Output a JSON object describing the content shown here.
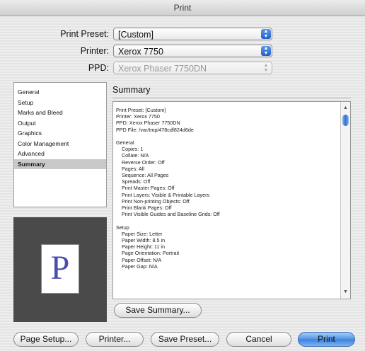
{
  "window": {
    "title": "Print"
  },
  "settings": {
    "print_preset": {
      "label": "Print Preset:",
      "value": "[Custom]"
    },
    "printer": {
      "label": "Printer:",
      "value": "Xerox 7750"
    },
    "ppd": {
      "label": "PPD:",
      "value": "Xerox Phaser 7750DN"
    }
  },
  "sidebar": {
    "items": [
      {
        "label": "General"
      },
      {
        "label": "Setup"
      },
      {
        "label": "Marks and Bleed"
      },
      {
        "label": "Output"
      },
      {
        "label": "Graphics"
      },
      {
        "label": "Color Management"
      },
      {
        "label": "Advanced"
      },
      {
        "label": "Summary",
        "selected": true
      }
    ]
  },
  "preview": {
    "letter": "P"
  },
  "summary": {
    "heading": "Summary",
    "text": "Print Preset: [Custom]\nPrinter: Xerox 7750\nPPD: Xerox Phaser 7750DN\nPPD File: /var/tmp/478cdf824d6de\n\nGeneral\n    Copies: 1\n    Collate: N/A\n    Reverse Order: Off\n    Pages: All\n    Sequence: All Pages\n    Spreads: Off\n    Print Master Pages: Off\n    Print Layers: Visible & Printable Layers\n    Print Non-printing Objects: Off\n    Print Blank Pages: Off\n    Print Visible Guides and Baseline Grids: Off\n\nSetup\n    Paper Size: Letter\n    Paper Width: 8.5 in\n    Paper Height: 11 in\n    Page Orientation: Portrait\n    Paper Offset: N/A\n    Paper Gap: N/A"
  },
  "buttons": {
    "save_summary": "Save Summary...",
    "page_setup": "Page Setup...",
    "printer": "Printer...",
    "save_preset": "Save Preset...",
    "cancel": "Cancel",
    "print": "Print"
  }
}
